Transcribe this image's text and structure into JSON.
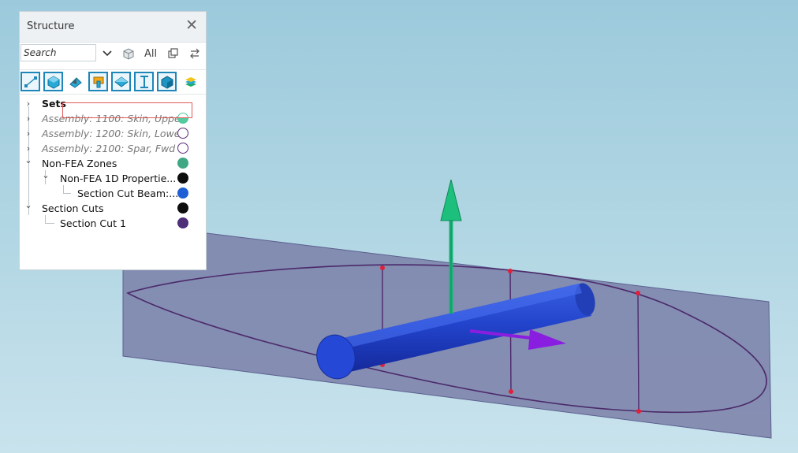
{
  "panel": {
    "title": "Structure",
    "close_label": "✕",
    "search_placeholder": "Search",
    "all_label": "All"
  },
  "filter_icons": [
    "node-icon",
    "solid-body-icon",
    "surface-icon",
    "property-icon",
    "plate-icon",
    "beam-icon",
    "volume-icon",
    "layers-icon"
  ],
  "tree": [
    {
      "label": "Sets",
      "style": "bold",
      "expander": "›",
      "color": null
    },
    {
      "label": "Assembly: 1100: Skin, Upper",
      "style": "italic",
      "expander": "›",
      "color": "#55c9a0",
      "dot_style": "half"
    },
    {
      "label": "Assembly: 1200: Skin, Lower",
      "style": "italic",
      "expander": "›",
      "color": "#5b2d7a",
      "dot_style": "ring"
    },
    {
      "label": "Assembly: 2100: Spar, Fwd",
      "style": "italic",
      "expander": "›",
      "color": "#5b2d7a",
      "dot_style": "ring"
    },
    {
      "label": "Non-FEA Zones",
      "style": "normal",
      "expander": "⌄",
      "color": "#3fa783",
      "dot_style": "fill"
    },
    {
      "label": "Non-FEA 1D Propertie...",
      "style": "normal",
      "expander": "⌄",
      "color": "#0d0d0d",
      "dot_style": "fill"
    },
    {
      "label": "Section Cut Beam:...",
      "style": "normal",
      "expander": "",
      "color": "#1f5fd6",
      "dot_style": "fill"
    },
    {
      "label": "Section Cuts",
      "style": "normal",
      "expander": "⌄",
      "color": "#0d0d0d",
      "dot_style": "fill"
    },
    {
      "label": "Section Cut 1",
      "style": "normal",
      "expander": "",
      "color": "#4f2f78",
      "dot_style": "fill"
    }
  ],
  "colors": {
    "viewport_bg": "#a9d1e1",
    "plane_fill": "#7a7fa8",
    "airfoil_line": "#4b2a6a",
    "beam": "#1e3fc4",
    "axis_green": "#19b777",
    "axis_purple": "#8a1ee0",
    "node_red": "#e0203a",
    "selection_border": "#e05a5a"
  }
}
